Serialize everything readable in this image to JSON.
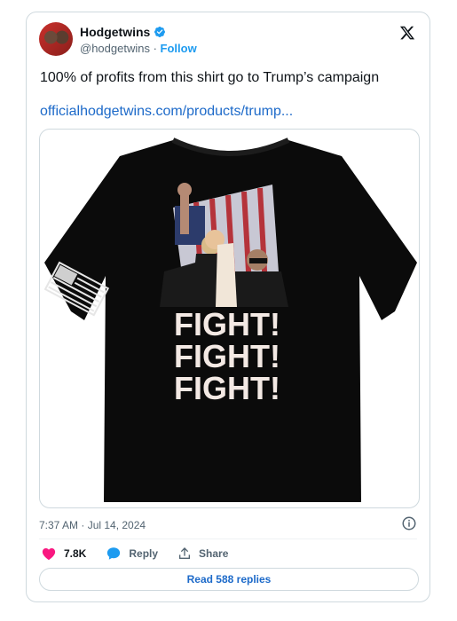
{
  "author": {
    "name": "Hodgetwins",
    "handle": "@hodgetwins",
    "separator": " · ",
    "follow_label": "Follow"
  },
  "tweet": {
    "text": "100% of profits from this shirt go to Trump’s campaign",
    "link": "officialhodgetwins.com/products/trump..."
  },
  "media": {
    "shirt_text_lines": [
      "FIGHT!",
      "FIGHT!",
      "FIGHT!"
    ]
  },
  "meta": {
    "timestamp": "7:37 AM · Jul 14, 2024"
  },
  "actions": {
    "likes_count": "7.8K",
    "reply_label": "Reply",
    "share_label": "Share"
  },
  "read_replies_label": "Read 588 replies",
  "colors": {
    "accent": "#1d9bf0",
    "link": "#1d6ac9",
    "heart": "#f91880",
    "muted": "#536471"
  },
  "icons": [
    "verified-badge-icon",
    "x-logo-icon",
    "info-icon",
    "heart-icon",
    "reply-bubble-icon",
    "share-icon"
  ]
}
